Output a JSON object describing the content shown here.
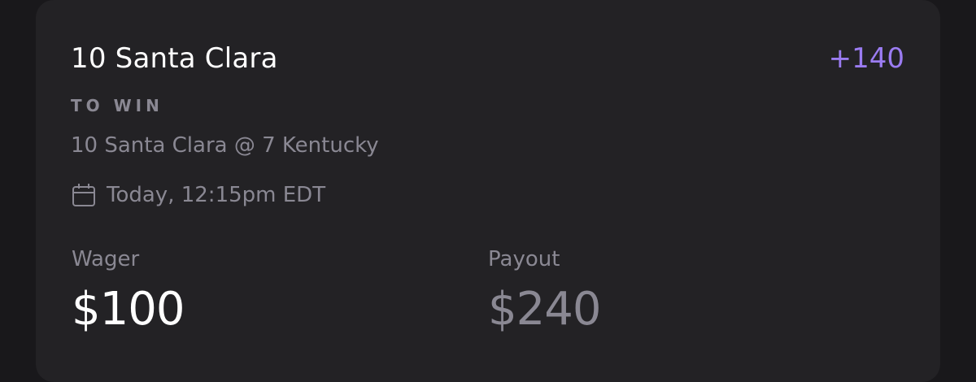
{
  "bet": {
    "title": "10 Santa Clara",
    "odds": "+140",
    "market": "TO WIN",
    "matchup": "10 Santa Clara @ 7 Kentucky",
    "datetime": "Today, 12:15pm EDT"
  },
  "wager": {
    "label": "Wager",
    "value": "$100"
  },
  "payout": {
    "label": "Payout",
    "value": "$240"
  },
  "icons": {
    "datetime_icon": "calendar-icon"
  },
  "colors": {
    "background": "#19181b",
    "card": "#232225",
    "accent": "#9b7cf2",
    "muted_text": "#8a8893",
    "primary_text": "#ffffff"
  }
}
